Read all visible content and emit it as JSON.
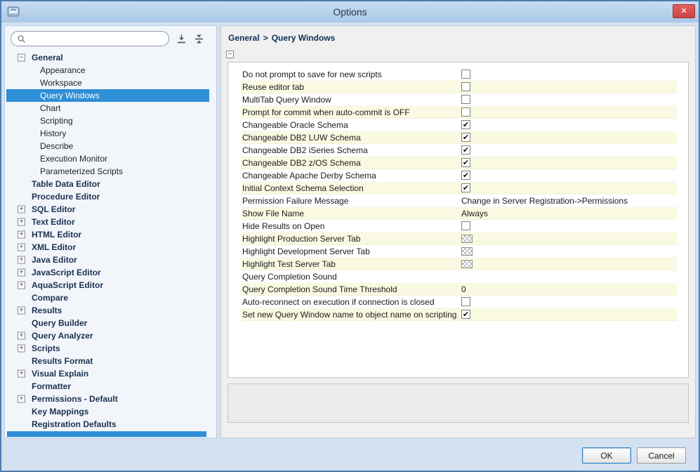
{
  "window": {
    "title": "Options",
    "close_glyph": "✕"
  },
  "icons": {
    "check_glyph": "✔",
    "minus": "−",
    "plus": "+"
  },
  "colors": {
    "selection_blue": "#2e8fd6",
    "close_red": "#d94f4f",
    "alt_row_yellow": "#fafae3",
    "titlebar_blue": "#a9c7e5"
  },
  "sidebar": {
    "search": {
      "placeholder": ""
    },
    "tree": [
      {
        "label": "General",
        "level": 0,
        "toggle": "minus",
        "bold": true,
        "selected": false
      },
      {
        "label": "Appearance",
        "level": 1,
        "toggle": "none",
        "bold": false,
        "selected": false
      },
      {
        "label": "Workspace",
        "level": 1,
        "toggle": "none",
        "bold": false,
        "selected": false
      },
      {
        "label": "Query Windows",
        "level": 1,
        "toggle": "none",
        "bold": false,
        "selected": true
      },
      {
        "label": "Chart",
        "level": 1,
        "toggle": "none",
        "bold": false,
        "selected": false
      },
      {
        "label": "Scripting",
        "level": 1,
        "toggle": "none",
        "bold": false,
        "selected": false
      },
      {
        "label": "History",
        "level": 1,
        "toggle": "none",
        "bold": false,
        "selected": false
      },
      {
        "label": "Describe",
        "level": 1,
        "toggle": "none",
        "bold": false,
        "selected": false
      },
      {
        "label": "Execution Monitor",
        "level": 1,
        "toggle": "none",
        "bold": false,
        "selected": false
      },
      {
        "label": "Parameterized Scripts",
        "level": 1,
        "toggle": "none",
        "bold": false,
        "selected": false
      },
      {
        "label": "Table Data Editor",
        "level": 0,
        "toggle": "none",
        "bold": true,
        "selected": false
      },
      {
        "label": "Procedure Editor",
        "level": 0,
        "toggle": "none",
        "bold": true,
        "selected": false
      },
      {
        "label": "SQL Editor",
        "level": 0,
        "toggle": "plus",
        "bold": true,
        "selected": false
      },
      {
        "label": "Text Editor",
        "level": 0,
        "toggle": "plus",
        "bold": true,
        "selected": false
      },
      {
        "label": "HTML Editor",
        "level": 0,
        "toggle": "plus",
        "bold": true,
        "selected": false
      },
      {
        "label": "XML Editor",
        "level": 0,
        "toggle": "plus",
        "bold": true,
        "selected": false
      },
      {
        "label": "Java Editor",
        "level": 0,
        "toggle": "plus",
        "bold": true,
        "selected": false
      },
      {
        "label": "JavaScript Editor",
        "level": 0,
        "toggle": "plus",
        "bold": true,
        "selected": false
      },
      {
        "label": "AquaScript Editor",
        "level": 0,
        "toggle": "plus",
        "bold": true,
        "selected": false
      },
      {
        "label": "Compare",
        "level": 0,
        "toggle": "none",
        "bold": true,
        "selected": false
      },
      {
        "label": "Results",
        "level": 0,
        "toggle": "plus",
        "bold": true,
        "selected": false
      },
      {
        "label": "Query Builder",
        "level": 0,
        "toggle": "none",
        "bold": true,
        "selected": false
      },
      {
        "label": "Query Analyzer",
        "level": 0,
        "toggle": "plus",
        "bold": true,
        "selected": false
      },
      {
        "label": "Scripts",
        "level": 0,
        "toggle": "plus",
        "bold": true,
        "selected": false
      },
      {
        "label": "Results Format",
        "level": 0,
        "toggle": "none",
        "bold": true,
        "selected": false
      },
      {
        "label": "Visual Explain",
        "level": 0,
        "toggle": "plus",
        "bold": true,
        "selected": false
      },
      {
        "label": "Formatter",
        "level": 0,
        "toggle": "none",
        "bold": true,
        "selected": false
      },
      {
        "label": "Permissions - Default",
        "level": 0,
        "toggle": "plus",
        "bold": true,
        "selected": false
      },
      {
        "label": "Key Mappings",
        "level": 0,
        "toggle": "none",
        "bold": true,
        "selected": false
      },
      {
        "label": "Registration Defaults",
        "level": 0,
        "toggle": "none",
        "bold": true,
        "selected": false
      }
    ]
  },
  "content": {
    "breadcrumb": {
      "parts": [
        "General",
        "Query Windows"
      ],
      "separator": ">"
    },
    "settings": [
      {
        "label": "Do not prompt to save for new scripts",
        "type": "checkbox",
        "checked": false
      },
      {
        "label": "Reuse editor tab",
        "type": "checkbox",
        "checked": false
      },
      {
        "label": "MultiTab Query Window",
        "type": "checkbox",
        "checked": false
      },
      {
        "label": "Prompt for commit when auto-commit is OFF",
        "type": "checkbox",
        "checked": false
      },
      {
        "label": "Changeable Oracle Schema",
        "type": "checkbox",
        "checked": true
      },
      {
        "label": "Changeable DB2 LUW Schema",
        "type": "checkbox",
        "checked": true
      },
      {
        "label": "Changeable DB2 iSeries Schema",
        "type": "checkbox",
        "checked": true
      },
      {
        "label": "Changeable DB2 z/OS Schema",
        "type": "checkbox",
        "checked": true
      },
      {
        "label": "Changeable Apache Derby Schema",
        "type": "checkbox",
        "checked": true
      },
      {
        "label": "Initial Context Schema Selection",
        "type": "checkbox",
        "checked": true
      },
      {
        "label": "Permission Failure Message",
        "type": "text",
        "value": "Change in Server Registration->Permissions"
      },
      {
        "label": "Show File Name",
        "type": "text",
        "value": "Always"
      },
      {
        "label": "Hide Results on Open",
        "type": "checkbox",
        "checked": false
      },
      {
        "label": "Highlight Production Server Tab",
        "type": "swatch"
      },
      {
        "label": "Highlight Development Server Tab",
        "type": "swatch"
      },
      {
        "label": "Highlight Test Server Tab",
        "type": "swatch"
      },
      {
        "label": "Query Completion Sound",
        "type": "empty"
      },
      {
        "label": "Query Completion Sound Time Threshold",
        "type": "text",
        "value": "0"
      },
      {
        "label": "Auto-reconnect on execution if connection is closed",
        "type": "checkbox",
        "checked": false
      },
      {
        "label": "Set new Query Window name to object name on scripting",
        "type": "checkbox",
        "checked": true
      }
    ]
  },
  "footer": {
    "ok": "OK",
    "cancel": "Cancel"
  }
}
